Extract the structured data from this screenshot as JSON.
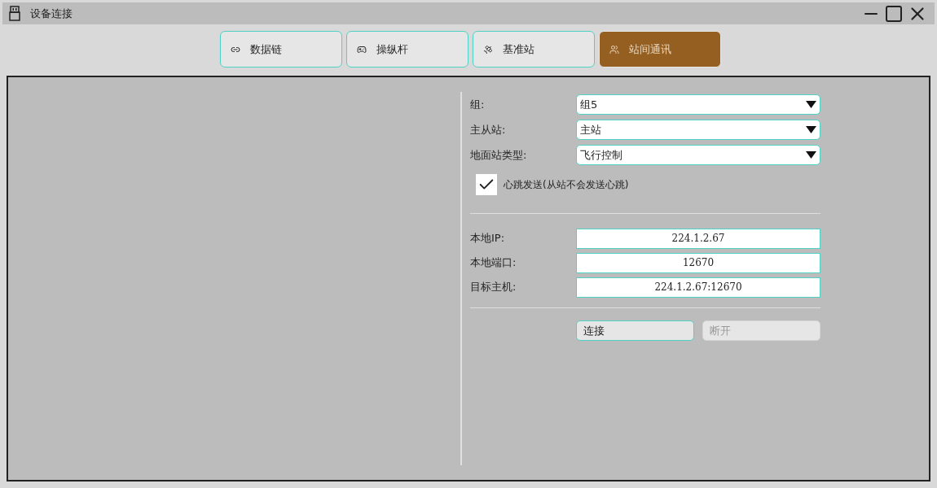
{
  "window": {
    "title": "设备连接"
  },
  "tabs": [
    {
      "label": "数据链",
      "selected": false
    },
    {
      "label": "操纵杆",
      "selected": false
    },
    {
      "label": "基准站",
      "selected": false
    },
    {
      "label": "站间通讯",
      "selected": true
    }
  ],
  "selects": [
    {
      "label": "组:",
      "value": "组5"
    },
    {
      "label": "主从站:",
      "value": "主站"
    },
    {
      "label": "地面站类型:",
      "value": "飞行控制"
    }
  ],
  "heartbeat": {
    "label": "心跳发送(从站不会发送心跳)",
    "checked": true
  },
  "fields": [
    {
      "label": "本地IP:",
      "value": "224.1.2.67"
    },
    {
      "label": "本地端口:",
      "value": "12670"
    },
    {
      "label": "目标主机:",
      "value": "224.1.2.67:12670"
    }
  ],
  "buttons": [
    {
      "label": "连接",
      "disabled": false
    },
    {
      "label": "断开",
      "disabled": true
    }
  ]
}
